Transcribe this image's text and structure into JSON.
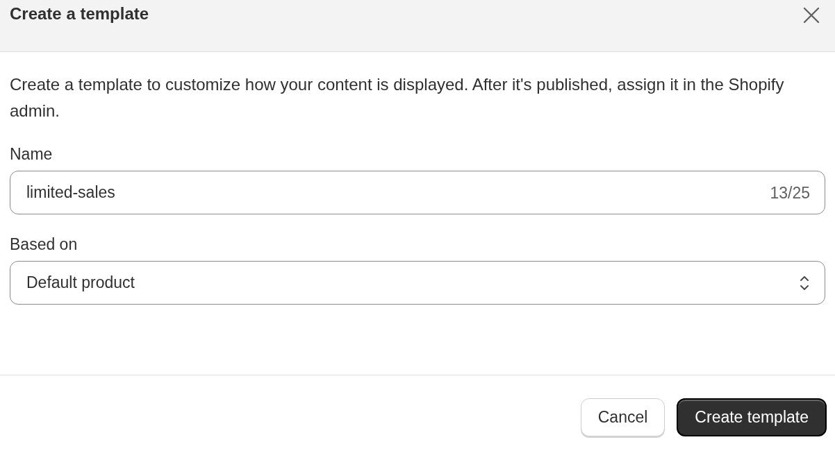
{
  "dialog": {
    "title": "Create a template"
  },
  "description": "Create a template to customize how your content is displayed. After it's published, assign it in the Shopify admin.",
  "name_field": {
    "label": "Name",
    "value": "limited-sales",
    "counter": "13/25"
  },
  "based_on": {
    "label": "Based on",
    "value": "Default product"
  },
  "buttons": [
    {
      "label": "Cancel",
      "kind": "secondary"
    },
    {
      "label": "Create template",
      "kind": "primary"
    }
  ]
}
